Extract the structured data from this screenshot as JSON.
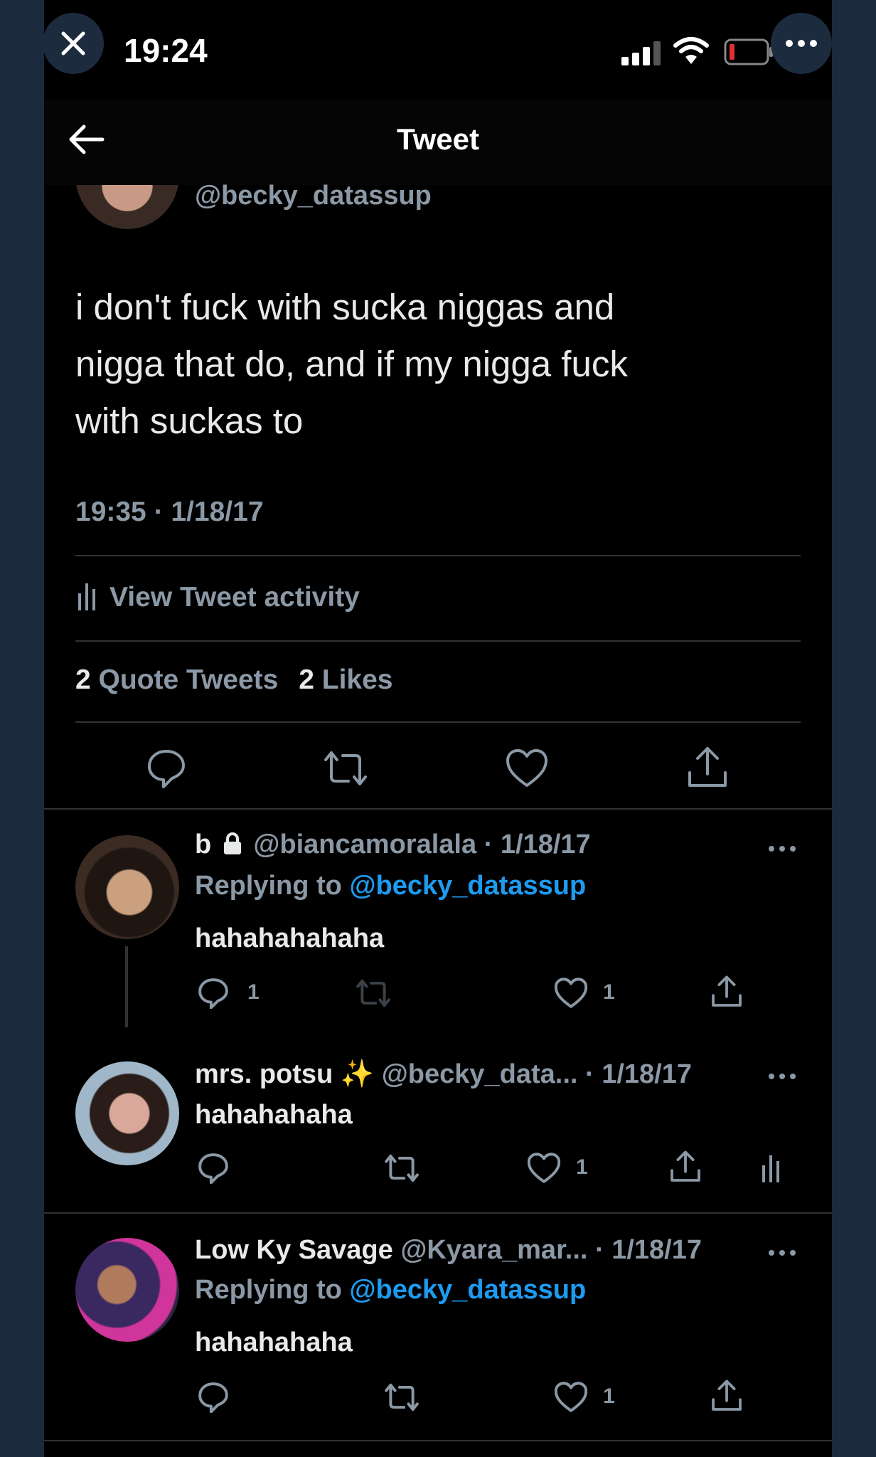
{
  "status_bar": {
    "time": "19:24",
    "icons": [
      "cellular-signal-icon",
      "wifi-icon",
      "battery-low-icon"
    ]
  },
  "overlay": {
    "close_icon": "close-icon",
    "more_icon": "more-icon"
  },
  "header": {
    "title": "Tweet",
    "back_icon": "back-arrow-icon"
  },
  "tweet": {
    "handle": "@becky_datassup",
    "text_lines": [
      "i don't fuck with sucka niggas and",
      "nigga that do, and if my nigga fuck",
      "with suckas to"
    ],
    "timestamp": "19:35 · 1/18/17",
    "activity_label": "View Tweet activity",
    "quote_count": "2",
    "quote_label": "Quote Tweets",
    "likes_count": "2",
    "likes_label": "Likes"
  },
  "replies": [
    {
      "name": "b",
      "lock_icon": "lock-icon",
      "handle": "@biancamoralala",
      "date": "· 1/18/17",
      "replying_prefix": "Replying to",
      "replying_handle": "@becky_datassup",
      "text": "hahahahahaha",
      "reply_count": "1",
      "like_count": "1"
    },
    {
      "name": "mrs. potsu",
      "emoji": "✨",
      "handle": "@becky_data...",
      "date": "· 1/18/17",
      "text": "hahahahaha",
      "like_count": "1"
    },
    {
      "name": "Low Ky Savage",
      "handle": "@Kyara_mar...",
      "date": "· 1/18/17",
      "replying_prefix": "Replying to",
      "replying_handle": "@becky_datassup",
      "text": "hahahahaha",
      "like_count": "1"
    }
  ],
  "colors": {
    "background": "#000000",
    "outer_background": "#1b2a3d",
    "text": "#e7e9ea",
    "muted": "#8b98a5",
    "link": "#1d9bf0",
    "divider": "#2f3336"
  }
}
